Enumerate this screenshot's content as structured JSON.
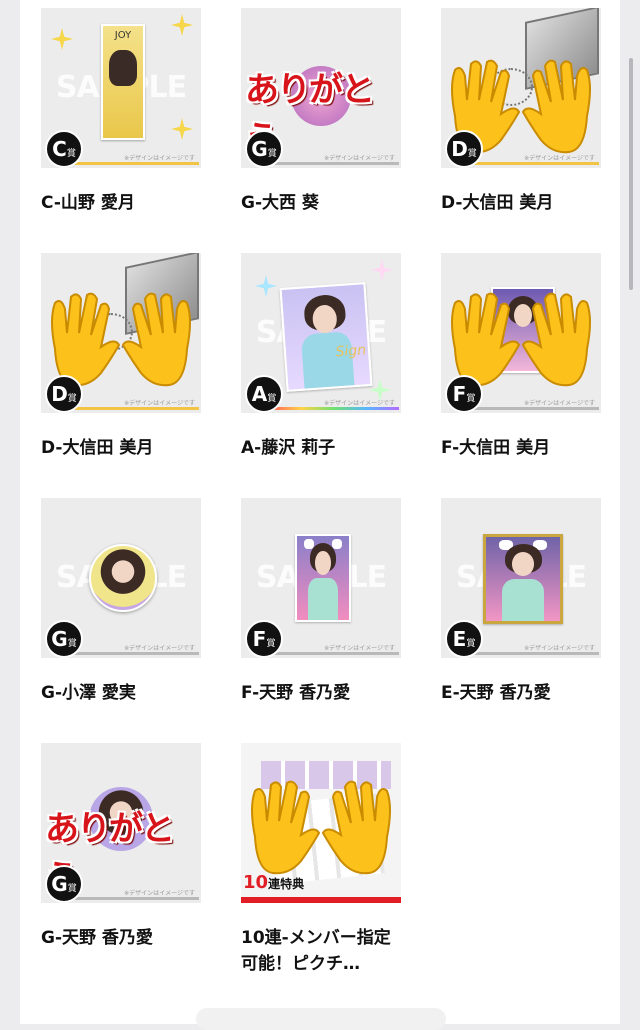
{
  "watermark": "SAMPLE",
  "disclaimer": "※デザインはイメージです",
  "stand_label": "JOY",
  "arigato_text": "ありがとう",
  "sign_text": "Sign",
  "ten_bonus": {
    "num": "10",
    "text": "連特典"
  },
  "prizes": [
    {
      "grade": "C",
      "suffix": "賞",
      "name": "C-山野 愛月",
      "type": "stand"
    },
    {
      "grade": "G",
      "suffix": "賞",
      "name": "G-大西 葵",
      "type": "arigato"
    },
    {
      "grade": "D",
      "suffix": "賞",
      "name": "D-大信田 美月",
      "type": "cube"
    },
    {
      "grade": "D",
      "suffix": "賞",
      "name": "D-大信田 美月",
      "type": "cube"
    },
    {
      "grade": "A",
      "suffix": "賞",
      "name": "A-藤沢 莉子",
      "type": "signed-photo"
    },
    {
      "grade": "F",
      "suffix": "賞",
      "name": "F-大信田 美月",
      "type": "photo-hands"
    },
    {
      "grade": "G",
      "suffix": "賞",
      "name": "G-小澤 愛実",
      "type": "badge-can"
    },
    {
      "grade": "F",
      "suffix": "賞",
      "name": "F-天野 香乃愛",
      "type": "photo"
    },
    {
      "grade": "E",
      "suffix": "賞",
      "name": "E-天野 香乃愛",
      "type": "photo-framed"
    },
    {
      "grade": "G",
      "suffix": "賞",
      "name": "G-天野 香乃愛",
      "type": "arigato"
    },
    {
      "grade": "",
      "suffix": "",
      "name": "10連-メンバー指定可能！ピクチ…",
      "type": "ten-bonus"
    }
  ],
  "colors": {
    "accent_red": "#e11e26",
    "badge_bg": "#111111",
    "page_bg": "#ffffff"
  },
  "icons": [
    "waving-hands-icon",
    "sparkle-icon"
  ]
}
